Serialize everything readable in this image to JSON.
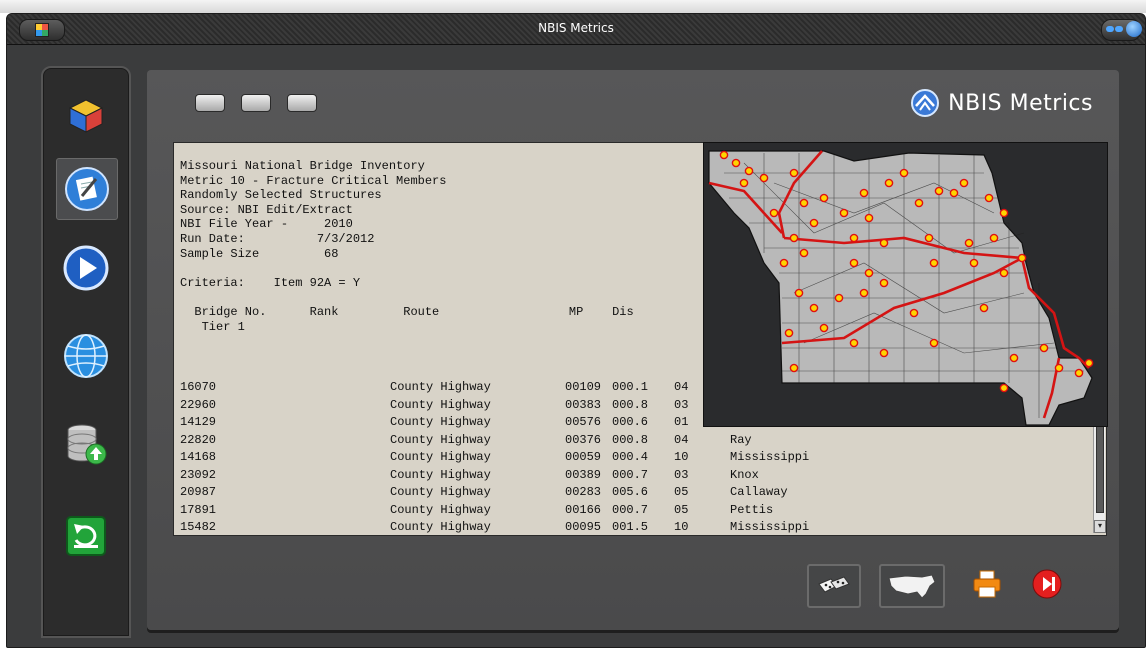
{
  "window": {
    "title": "NBIS Metrics"
  },
  "brand": {
    "name": "NBIS Metrics"
  },
  "sidebar": {
    "items": [
      {
        "name": "cube-icon"
      },
      {
        "name": "edit-document-icon"
      },
      {
        "name": "play-icon"
      },
      {
        "name": "globe-icon"
      },
      {
        "name": "database-upload-icon"
      },
      {
        "name": "refresh-icon"
      }
    ]
  },
  "report": {
    "header_lines": [
      "Missouri National Bridge Inventory",
      "Metric 10 - Fracture Critical Members",
      "Randomly Selected Structures",
      "Source: NBI Edit/Extract",
      "NBI File Year -     2010",
      "Run Date:          7/3/2012",
      "Sample Size         68",
      "",
      "Criteria:    Item 92A = Y",
      "",
      "  Bridge No.      Rank         Route                  MP    Dis",
      "   Tier 1"
    ],
    "rows": [
      {
        "bridge": "16070",
        "route": "County Highway",
        "route_no": "00109",
        "mp": "000.1",
        "dist": "04",
        "county": ""
      },
      {
        "bridge": "22960",
        "route": "County Highway",
        "route_no": "00383",
        "mp": "000.8",
        "dist": "03",
        "county": ""
      },
      {
        "bridge": "14129",
        "route": "County Highway",
        "route_no": "00576",
        "mp": "000.6",
        "dist": "01",
        "county": ""
      },
      {
        "bridge": "22820",
        "route": "County Highway",
        "route_no": "00376",
        "mp": "000.8",
        "dist": "04",
        "county": "Ray"
      },
      {
        "bridge": "14168",
        "route": "County Highway",
        "route_no": "00059",
        "mp": "000.4",
        "dist": "10",
        "county": "Mississippi"
      },
      {
        "bridge": "23092",
        "route": "County Highway",
        "route_no": "00389",
        "mp": "000.7",
        "dist": "03",
        "county": "Knox"
      },
      {
        "bridge": "20987",
        "route": "County Highway",
        "route_no": "00283",
        "mp": "005.6",
        "dist": "05",
        "county": "Callaway"
      },
      {
        "bridge": "17891",
        "route": "County Highway",
        "route_no": "00166",
        "mp": "000.7",
        "dist": "05",
        "county": "Pettis"
      },
      {
        "bridge": "15482",
        "route": "County Highway",
        "route_no": "00095",
        "mp": "001.5",
        "dist": "10",
        "county": "Mississippi"
      }
    ]
  },
  "map": {
    "name": "missouri-bridge-map",
    "accent_route": "#d41414",
    "marker_fill": "#ffd400",
    "marker_stroke": "#e01010"
  },
  "colors": {
    "panel": "#505051",
    "report_bg": "#d8d3c8",
    "sidebar": "#2c2c2c"
  }
}
